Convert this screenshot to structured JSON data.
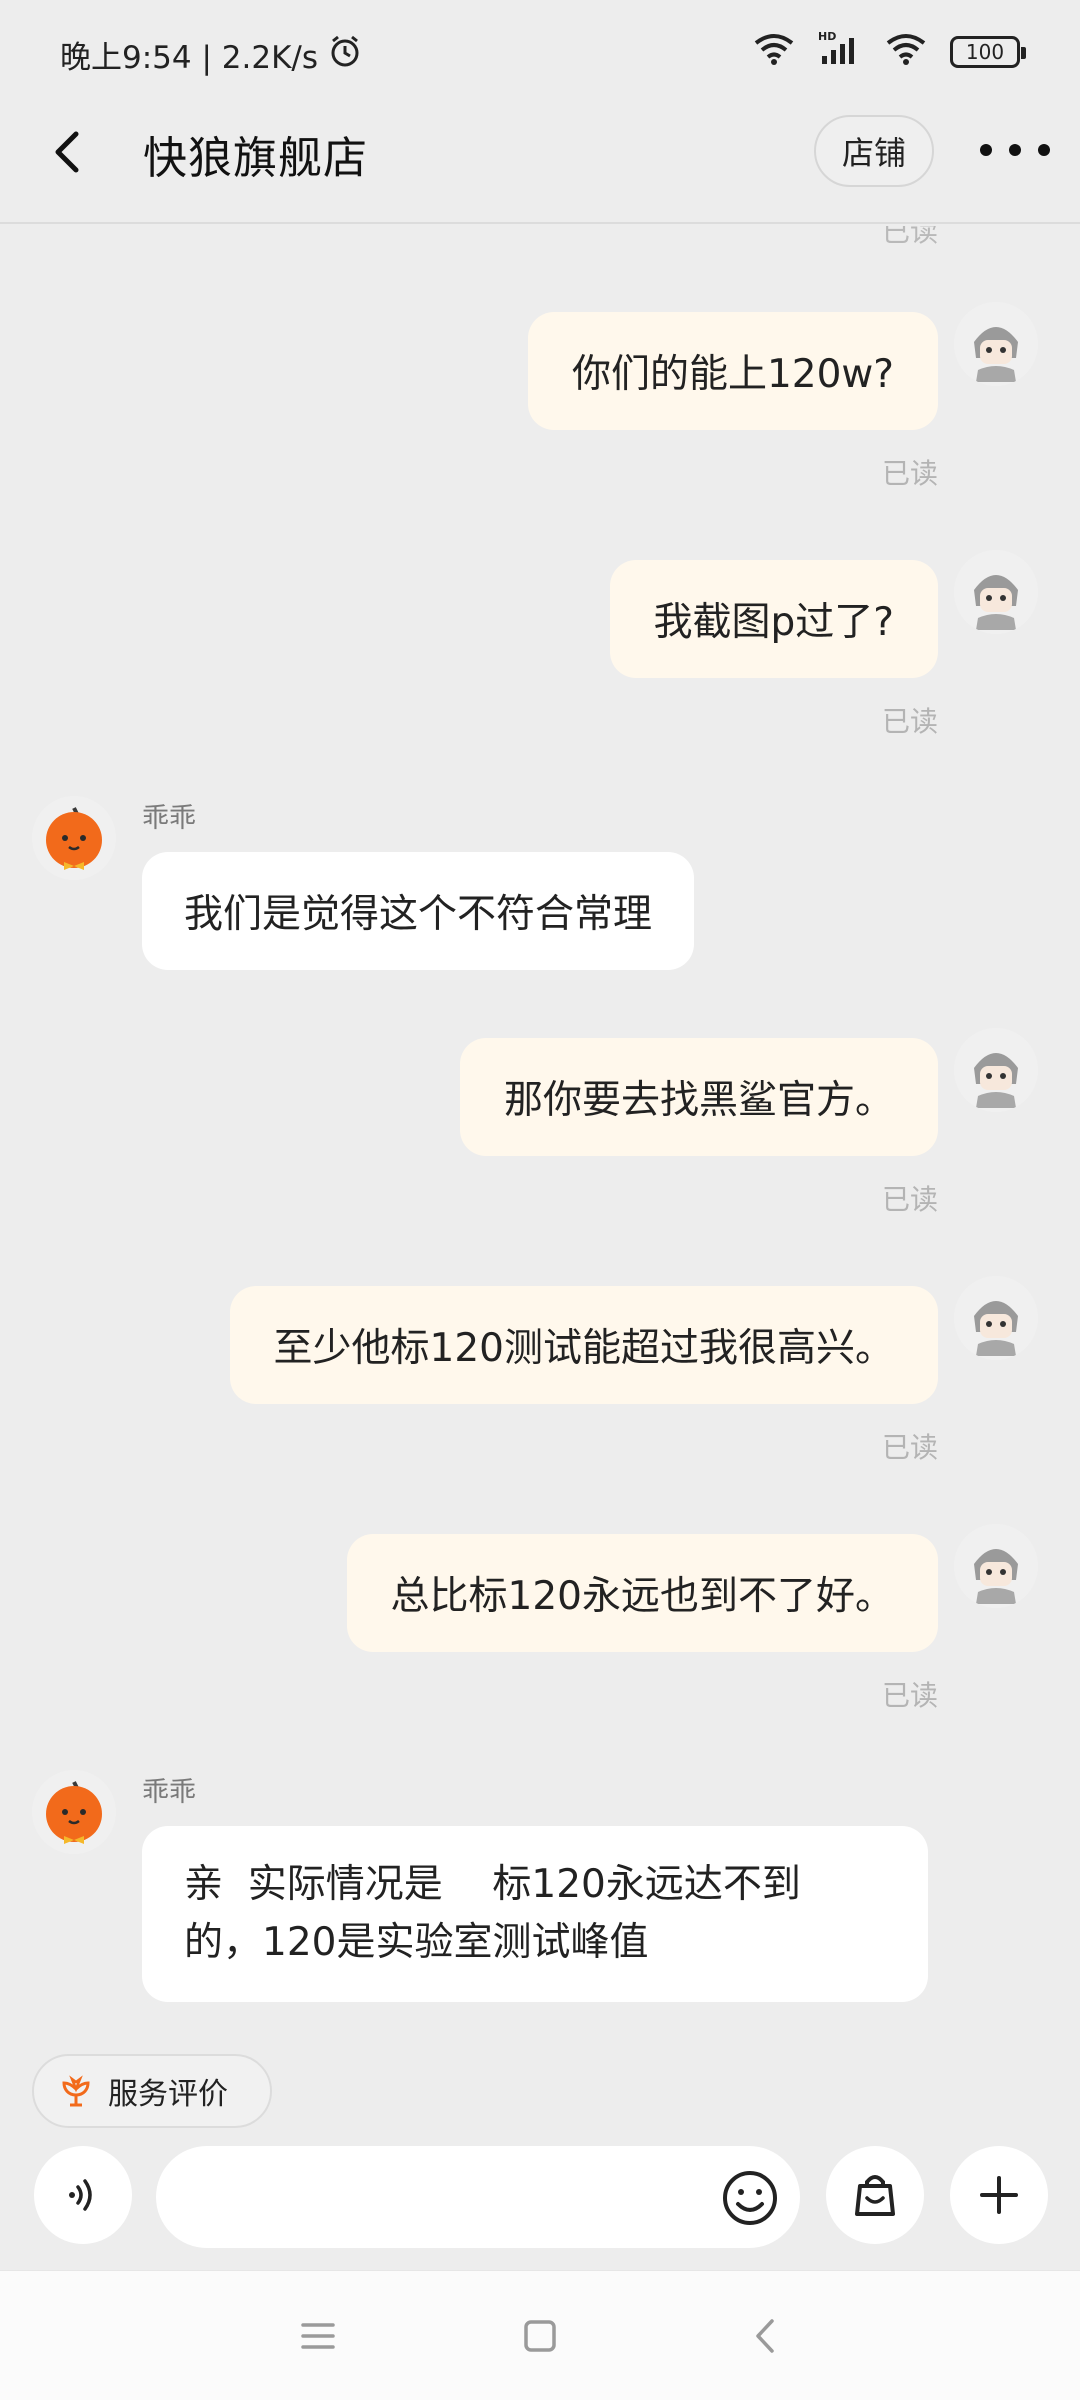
{
  "status_bar": {
    "time": "晚上9:54 | 2.2K/s",
    "battery": "100",
    "icons": [
      "alarm-icon",
      "wifi-icon",
      "hd-signal-icon",
      "wifi-icon",
      "battery-icon"
    ]
  },
  "header": {
    "title": "快狼旗舰店",
    "shop_button": "店铺"
  },
  "chat": {
    "top_read": "已读",
    "messages": [
      {
        "side": "out",
        "text": "你们的能上120w?",
        "read": "已读"
      },
      {
        "side": "out",
        "text": "我截图p过了?",
        "read": "已读"
      },
      {
        "side": "in",
        "sender": "乖乖",
        "text": "我们是觉得这个不符合常理"
      },
      {
        "side": "out",
        "text": "那你要去找黑鲨官方。",
        "read": "已读"
      },
      {
        "side": "out",
        "text": "至少他标120测试能超过我很高兴。",
        "read": "已读"
      },
      {
        "side": "out",
        "text": "总比标120永远也到不了好。",
        "read": "已读"
      },
      {
        "side": "in",
        "sender": "乖乖",
        "lines": [
          "亲  实际情况是    标120永远达不到",
          "的，120是实验室测试峰值"
        ]
      }
    ]
  },
  "bottom": {
    "eval_chip": "服务评价",
    "input_placeholder": ""
  },
  "colors": {
    "background": "#ededed",
    "outgoing_bubble": "#fff8ec",
    "incoming_bubble": "#ffffff",
    "shop_avatar": "#f26a1b"
  }
}
